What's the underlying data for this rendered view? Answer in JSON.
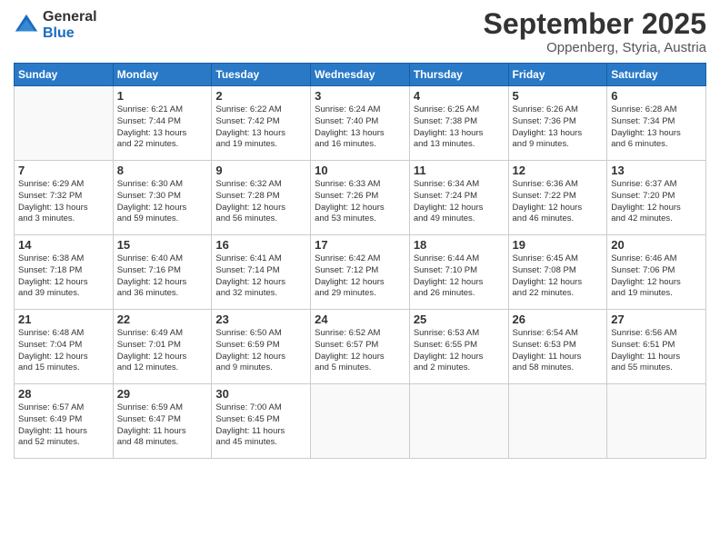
{
  "header": {
    "logo_general": "General",
    "logo_blue": "Blue",
    "month_year": "September 2025",
    "location": "Oppenberg, Styria, Austria"
  },
  "days_of_week": [
    "Sunday",
    "Monday",
    "Tuesday",
    "Wednesday",
    "Thursday",
    "Friday",
    "Saturday"
  ],
  "weeks": [
    [
      {
        "day": "",
        "info": ""
      },
      {
        "day": "1",
        "info": "Sunrise: 6:21 AM\nSunset: 7:44 PM\nDaylight: 13 hours\nand 22 minutes."
      },
      {
        "day": "2",
        "info": "Sunrise: 6:22 AM\nSunset: 7:42 PM\nDaylight: 13 hours\nand 19 minutes."
      },
      {
        "day": "3",
        "info": "Sunrise: 6:24 AM\nSunset: 7:40 PM\nDaylight: 13 hours\nand 16 minutes."
      },
      {
        "day": "4",
        "info": "Sunrise: 6:25 AM\nSunset: 7:38 PM\nDaylight: 13 hours\nand 13 minutes."
      },
      {
        "day": "5",
        "info": "Sunrise: 6:26 AM\nSunset: 7:36 PM\nDaylight: 13 hours\nand 9 minutes."
      },
      {
        "day": "6",
        "info": "Sunrise: 6:28 AM\nSunset: 7:34 PM\nDaylight: 13 hours\nand 6 minutes."
      }
    ],
    [
      {
        "day": "7",
        "info": "Sunrise: 6:29 AM\nSunset: 7:32 PM\nDaylight: 13 hours\nand 3 minutes."
      },
      {
        "day": "8",
        "info": "Sunrise: 6:30 AM\nSunset: 7:30 PM\nDaylight: 12 hours\nand 59 minutes."
      },
      {
        "day": "9",
        "info": "Sunrise: 6:32 AM\nSunset: 7:28 PM\nDaylight: 12 hours\nand 56 minutes."
      },
      {
        "day": "10",
        "info": "Sunrise: 6:33 AM\nSunset: 7:26 PM\nDaylight: 12 hours\nand 53 minutes."
      },
      {
        "day": "11",
        "info": "Sunrise: 6:34 AM\nSunset: 7:24 PM\nDaylight: 12 hours\nand 49 minutes."
      },
      {
        "day": "12",
        "info": "Sunrise: 6:36 AM\nSunset: 7:22 PM\nDaylight: 12 hours\nand 46 minutes."
      },
      {
        "day": "13",
        "info": "Sunrise: 6:37 AM\nSunset: 7:20 PM\nDaylight: 12 hours\nand 42 minutes."
      }
    ],
    [
      {
        "day": "14",
        "info": "Sunrise: 6:38 AM\nSunset: 7:18 PM\nDaylight: 12 hours\nand 39 minutes."
      },
      {
        "day": "15",
        "info": "Sunrise: 6:40 AM\nSunset: 7:16 PM\nDaylight: 12 hours\nand 36 minutes."
      },
      {
        "day": "16",
        "info": "Sunrise: 6:41 AM\nSunset: 7:14 PM\nDaylight: 12 hours\nand 32 minutes."
      },
      {
        "day": "17",
        "info": "Sunrise: 6:42 AM\nSunset: 7:12 PM\nDaylight: 12 hours\nand 29 minutes."
      },
      {
        "day": "18",
        "info": "Sunrise: 6:44 AM\nSunset: 7:10 PM\nDaylight: 12 hours\nand 26 minutes."
      },
      {
        "day": "19",
        "info": "Sunrise: 6:45 AM\nSunset: 7:08 PM\nDaylight: 12 hours\nand 22 minutes."
      },
      {
        "day": "20",
        "info": "Sunrise: 6:46 AM\nSunset: 7:06 PM\nDaylight: 12 hours\nand 19 minutes."
      }
    ],
    [
      {
        "day": "21",
        "info": "Sunrise: 6:48 AM\nSunset: 7:04 PM\nDaylight: 12 hours\nand 15 minutes."
      },
      {
        "day": "22",
        "info": "Sunrise: 6:49 AM\nSunset: 7:01 PM\nDaylight: 12 hours\nand 12 minutes."
      },
      {
        "day": "23",
        "info": "Sunrise: 6:50 AM\nSunset: 6:59 PM\nDaylight: 12 hours\nand 9 minutes."
      },
      {
        "day": "24",
        "info": "Sunrise: 6:52 AM\nSunset: 6:57 PM\nDaylight: 12 hours\nand 5 minutes."
      },
      {
        "day": "25",
        "info": "Sunrise: 6:53 AM\nSunset: 6:55 PM\nDaylight: 12 hours\nand 2 minutes."
      },
      {
        "day": "26",
        "info": "Sunrise: 6:54 AM\nSunset: 6:53 PM\nDaylight: 11 hours\nand 58 minutes."
      },
      {
        "day": "27",
        "info": "Sunrise: 6:56 AM\nSunset: 6:51 PM\nDaylight: 11 hours\nand 55 minutes."
      }
    ],
    [
      {
        "day": "28",
        "info": "Sunrise: 6:57 AM\nSunset: 6:49 PM\nDaylight: 11 hours\nand 52 minutes."
      },
      {
        "day": "29",
        "info": "Sunrise: 6:59 AM\nSunset: 6:47 PM\nDaylight: 11 hours\nand 48 minutes."
      },
      {
        "day": "30",
        "info": "Sunrise: 7:00 AM\nSunset: 6:45 PM\nDaylight: 11 hours\nand 45 minutes."
      },
      {
        "day": "",
        "info": ""
      },
      {
        "day": "",
        "info": ""
      },
      {
        "day": "",
        "info": ""
      },
      {
        "day": "",
        "info": ""
      }
    ]
  ]
}
